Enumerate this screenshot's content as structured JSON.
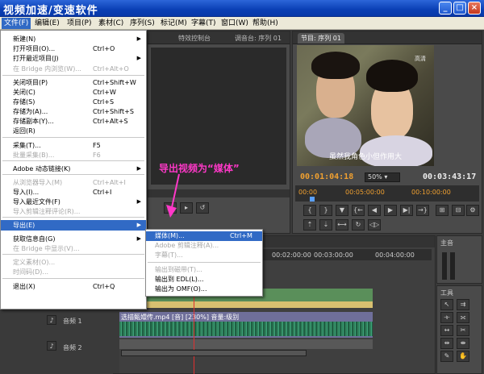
{
  "window": {
    "title": "视频加速/变速软件"
  },
  "menubar": {
    "items": [
      {
        "label": "文件(F)"
      },
      {
        "label": "编辑(E)"
      },
      {
        "label": "项目(P)"
      },
      {
        "label": "素材(C)"
      },
      {
        "label": "序列(S)"
      },
      {
        "label": "标记(M)"
      },
      {
        "label": "字幕(T)"
      },
      {
        "label": "窗口(W)"
      },
      {
        "label": "帮助(H)"
      }
    ]
  },
  "file_menu": {
    "items": [
      {
        "label": "新建(N)",
        "shortcut": "",
        "submenu": true,
        "disabled": false
      },
      {
        "label": "打开项目(O)...",
        "shortcut": "Ctrl+O",
        "submenu": false,
        "disabled": false
      },
      {
        "label": "打开最近项目(J)",
        "shortcut": "",
        "submenu": true,
        "disabled": false
      },
      {
        "label": "在 Bridge 内浏览(W)...",
        "shortcut": "Ctrl+Alt+O",
        "submenu": false,
        "disabled": true
      },
      {
        "label": "关闭项目(P)",
        "shortcut": "Ctrl+Shift+W",
        "submenu": false,
        "disabled": false
      },
      {
        "label": "关闭(C)",
        "shortcut": "Ctrl+W",
        "submenu": false,
        "disabled": false
      },
      {
        "label": "存储(S)",
        "shortcut": "Ctrl+S",
        "submenu": false,
        "disabled": false
      },
      {
        "label": "存储为(A)...",
        "shortcut": "Ctrl+Shift+S",
        "submenu": false,
        "disabled": false
      },
      {
        "label": "存储副本(Y)...",
        "shortcut": "Ctrl+Alt+S",
        "submenu": false,
        "disabled": false
      },
      {
        "label": "返回(R)",
        "shortcut": "",
        "submenu": false,
        "disabled": false
      },
      {
        "label": "采集(T)...",
        "shortcut": "F5",
        "submenu": false,
        "disabled": false
      },
      {
        "label": "批量采集(B)...",
        "shortcut": "F6",
        "submenu": false,
        "disabled": true
      },
      {
        "label": "Adobe 动态链接(K)",
        "shortcut": "",
        "submenu": true,
        "disabled": false
      },
      {
        "label": "从浏览器导入(M)",
        "shortcut": "Ctrl+Alt+I",
        "submenu": false,
        "disabled": true
      },
      {
        "label": "导入(I)...",
        "shortcut": "Ctrl+I",
        "submenu": false,
        "disabled": false
      },
      {
        "label": "导入最近文件(F)",
        "shortcut": "",
        "submenu": true,
        "disabled": false
      },
      {
        "label": "导入剪辑注释评论(R)...",
        "shortcut": "",
        "submenu": false,
        "disabled": true
      },
      {
        "label": "导出(E)",
        "shortcut": "",
        "submenu": true,
        "disabled": false
      },
      {
        "label": "获取信息自(G)",
        "shortcut": "",
        "submenu": true,
        "disabled": false
      },
      {
        "label": "在 Bridge 中显示(V)...",
        "shortcut": "",
        "submenu": false,
        "disabled": true
      },
      {
        "label": "定义素材(O)...",
        "shortcut": "",
        "submenu": false,
        "disabled": true
      },
      {
        "label": "时间码(D)...",
        "shortcut": "",
        "submenu": false,
        "disabled": true
      },
      {
        "label": "退出(X)",
        "shortcut": "Ctrl+Q",
        "submenu": false,
        "disabled": false
      }
    ]
  },
  "export_submenu": {
    "items": [
      {
        "label": "媒体(M)...",
        "shortcut": "Ctrl+M",
        "disabled": false
      },
      {
        "label": "Adobe 剪辑注释(A)...",
        "shortcut": "",
        "disabled": true
      },
      {
        "label": "字幕(T)...",
        "shortcut": "",
        "disabled": true
      },
      {
        "label": "输出到磁带(T)...",
        "shortcut": "",
        "disabled": true
      },
      {
        "label": "输出到 EDL(L)...",
        "shortcut": "",
        "disabled": false
      },
      {
        "label": "输出为 OMF(O)...",
        "shortcut": "",
        "disabled": false
      }
    ]
  },
  "annotation": {
    "text": "导出视频为“媒体”",
    "color": "#ff38c8"
  },
  "panels": {
    "source_tabs": [
      "特效控制台",
      "调音台: 序列 01"
    ],
    "program_tab": "节目: 序列 01",
    "program_timecode": "00:01:04:18",
    "program_zoom": "50%",
    "program_duration": "00:03:43:17",
    "ruler_labels": [
      "00:00",
      "00:05:00:00",
      "00:10:00:00"
    ],
    "timeline_ruler": [
      "00:02:00:00",
      "00:03:00:00",
      "00:04:00:00"
    ],
    "subtitle": "虽然我角色小但作用大",
    "video_logo": "高清",
    "audio_track_label": "音频 1",
    "audio_track2_label": "音频 2",
    "clip_label": "选描甄嬛传.mp4 [音] [230%] 音量:级别",
    "audio_master_tab": "主音",
    "tools_tab": "工具"
  },
  "colors": {
    "accent": "#316ac5",
    "timecode": "#f0a030",
    "highlight_pink": "#ff38c8"
  }
}
